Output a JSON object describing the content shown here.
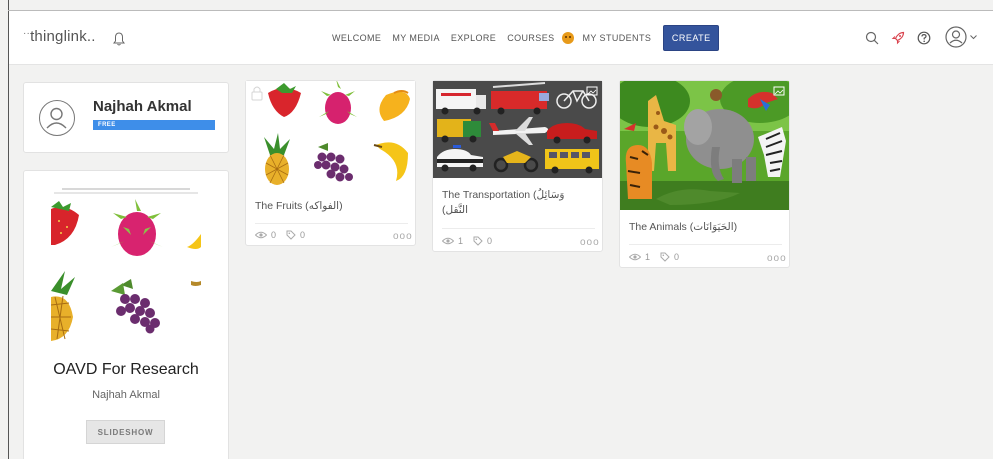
{
  "header": {
    "logo_text": "thinglink",
    "logo_suffix": "..",
    "nav": [
      {
        "label": "WELCOME"
      },
      {
        "label": "MY MEDIA"
      },
      {
        "label": "EXPLORE"
      },
      {
        "label": "COURSES"
      },
      {
        "label": "MY STUDENTS"
      }
    ],
    "create_label": "CREATE",
    "icons": [
      "bell-icon",
      "search-icon",
      "rocket-icon",
      "help-icon",
      "user-avatar-icon",
      "chevron-down-icon"
    ]
  },
  "profile": {
    "name": "Najhah Akmal",
    "plan": "FREE",
    "plan_color": "#3e8ee9"
  },
  "channel": {
    "title": "OAVD For Research",
    "owner": "Najhah Akmal",
    "button_label": "SLIDESHOW"
  },
  "media": [
    {
      "title": "The Fruits (الفواكه)",
      "views": "0",
      "tags": "0",
      "more": "ooo"
    },
    {
      "title": "The Transportation (وَسَائِلُ",
      "title_line2": "(النَّقل",
      "views": "1",
      "tags": "0",
      "more": "ooo"
    },
    {
      "title": "The Animals (الحَيَوَانَات)",
      "views": "1",
      "tags": "0",
      "more": "ooo"
    }
  ],
  "colors": {
    "accent": "#34549c",
    "background": "#f2f2f1"
  }
}
